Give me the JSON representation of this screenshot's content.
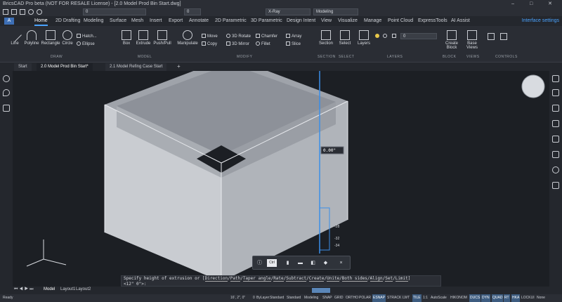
{
  "window": {
    "title": "BricsCAD Pro beta (NOT FOR RESALE License) - [2.0 Model Prod Bin Start.dwg]",
    "minimize": "–",
    "maximize": "□",
    "close": "✕"
  },
  "qat": {
    "layer_value": "0",
    "color_value": "0",
    "visual_style": "X-Ray",
    "workspace": "Modeling"
  },
  "ribbon_tabs": [
    "Home",
    "2D Drafting",
    "Modeling",
    "Surface",
    "Mesh",
    "Insert",
    "Export",
    "Annotate",
    "2D Parametric",
    "3D Parametric",
    "Design Intent",
    "View",
    "Visualize",
    "Manage",
    "Point Cloud",
    "ExpressTools",
    "AI Assist"
  ],
  "interface_settings": "Interface settings",
  "ribbon": {
    "draw": {
      "line": "Line",
      "polyline": "Polyline",
      "rectangle": "Rectangle",
      "circle": "Circle",
      "hatch": "Hatch...",
      "ellipse": "Ellipse"
    },
    "model": {
      "box": "Box",
      "extrude": "Extrude",
      "pushpull": "Push/Pull"
    },
    "manipulate": "Manipulate",
    "modify": {
      "move": "Move",
      "rotate3d": "3D Rotate",
      "chamfer": "Chamfer",
      "array": "Array",
      "copy": "Copy",
      "mirror3d": "3D Mirror",
      "fillet": "Fillet",
      "slice": "Slice"
    },
    "section": "Section",
    "select": "Select",
    "layers": "Layers",
    "layer_value": "0",
    "create_block": "Create Block",
    "base_views": "Base Views",
    "groups": {
      "draw": "DRAW",
      "model": "MODEL",
      "modify": "MODIFY",
      "section": "SECTION",
      "select": "SELECT",
      "layers": "LAYERS",
      "block": "BLOCK",
      "views": "VIEWS",
      "controls": "CONTROLS"
    }
  },
  "doc_tabs": [
    {
      "label": "Start"
    },
    {
      "label": "2.0 Model Prod Bin Start*"
    },
    {
      "label": "2.1 Model Refing Case Start"
    }
  ],
  "viewport": {
    "dimension_value": "0.00\"",
    "ruler_labels": [
      "-28",
      "-32",
      "-34"
    ]
  },
  "command_line": {
    "prompt": "Specify height of extrusion or [",
    "options": [
      "Direction",
      "Path",
      "Taper angle",
      "Rate",
      "Subtract",
      "Create",
      "Unite",
      "Both sides",
      "Align",
      "Set",
      "Limit"
    ],
    "close": "]",
    "input": "<12\" 0\">:"
  },
  "floating_toolbar": {
    "ctrl": "Ctrl",
    "close": "×"
  },
  "layout_tabs": {
    "model": "Model",
    "layout1": "Layout1",
    "layout2": "Layout2"
  },
  "status": {
    "ready": "Ready",
    "coords": "16', 2\", 0\"",
    "items": [
      "0",
      "ByLayer",
      "Standard",
      "Standard",
      "Modeling",
      "SNAP",
      "GRID",
      "ORTHO",
      "POLAR",
      "ESNAP",
      "STRACK",
      "LWT",
      "TILE",
      "1:1",
      "AutoScale",
      "HIKONOM",
      "DUCS",
      "DYN",
      "QUAD",
      "RT",
      "HKA",
      "LOCKUI",
      "None"
    ]
  }
}
